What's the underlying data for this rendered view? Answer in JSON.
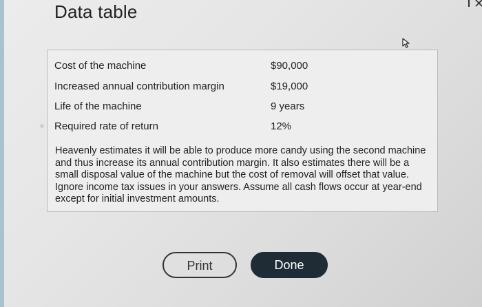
{
  "dialog": {
    "title": "Data table"
  },
  "table": {
    "rows": [
      {
        "label": "Cost of the machine",
        "value": "$90,000"
      },
      {
        "label": "Increased annual contribution margin",
        "value": "$19,000"
      },
      {
        "label": "Life of the machine",
        "value": "9 years"
      },
      {
        "label": "Required rate of return",
        "value": "12%"
      }
    ]
  },
  "description": "Heavenly estimates it will be able to produce more candy using the second machine and thus increase its annual contribution margin. It also estimates there will be a small disposal value of the machine but the cost of removal will offset that value. Ignore income tax issues in your answers. Assume all cash flows occur at year-end except for initial investment amounts.",
  "buttons": {
    "print": "Print",
    "done": "Done"
  },
  "icons": {
    "cursor": "hand-pointer-icon",
    "close": "close-icon"
  },
  "colors": {
    "done_button": "#1f2c36",
    "panel_border": "#b9b9b9"
  }
}
